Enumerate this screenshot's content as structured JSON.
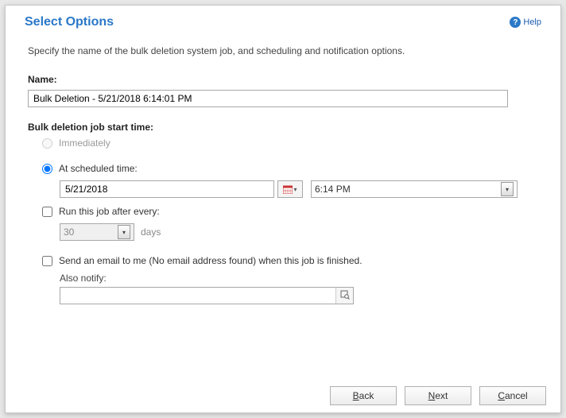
{
  "header": {
    "title": "Select Options",
    "help_label": "Help"
  },
  "instruction": "Specify the name of the bulk deletion system job, and scheduling and notification options.",
  "name": {
    "label": "Name:",
    "value": "Bulk Deletion - 5/21/2018 6:14:01 PM"
  },
  "start_time": {
    "label": "Bulk deletion job start time:",
    "immediately_label": "Immediately",
    "scheduled_label": "At scheduled time:",
    "selected": "scheduled",
    "date_value": "5/21/2018",
    "time_value": "6:14 PM"
  },
  "recurrence": {
    "label": "Run this job after every:",
    "value": "30",
    "unit": "days",
    "checked": false
  },
  "notify": {
    "email_label": "Send an email to me (No email address found) when this job is finished.",
    "checked": false,
    "also_notify_label": "Also notify:",
    "also_notify_value": ""
  },
  "buttons": {
    "back": "Back",
    "next": "Next",
    "cancel": "Cancel"
  }
}
